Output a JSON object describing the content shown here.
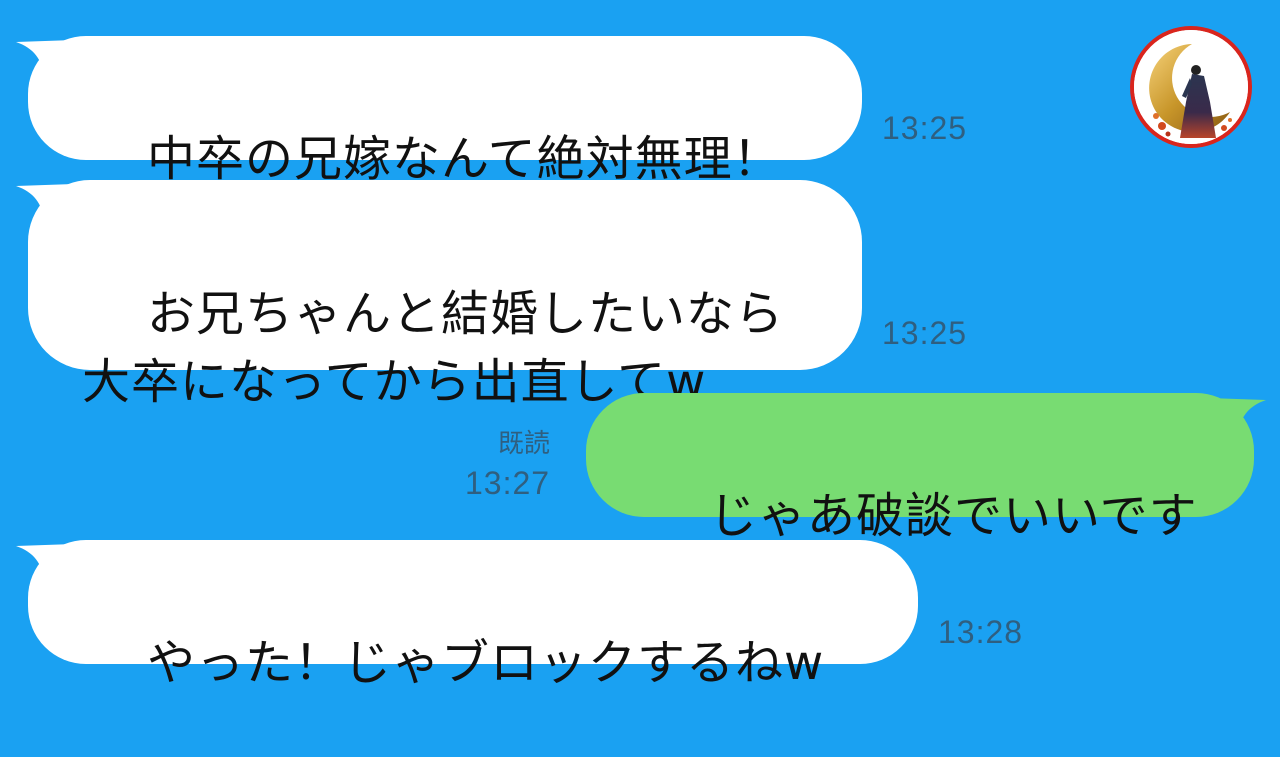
{
  "chat": {
    "messages": [
      {
        "sender": "other",
        "text": "中卒の兄嫁なんて絶対無理！",
        "time": "13:25"
      },
      {
        "sender": "other",
        "text": "お兄ちゃんと結婚したいなら\n大卒になってから出直してw",
        "time": "13:25"
      },
      {
        "sender": "self",
        "text": "じゃあ破談でいいです",
        "read": "既読",
        "time": "13:27"
      },
      {
        "sender": "other",
        "text": "やった！じゃブロックするねw",
        "time": "13:28"
      }
    ]
  },
  "colors": {
    "background": "#1aa1f2",
    "received_bubble": "#ffffff",
    "sent_bubble": "#78dc72",
    "meta_text": "#2f5f80",
    "avatar_border": "#d9251d"
  },
  "avatar": {
    "icon": "kimono-woman-crescent-moon-avatar"
  }
}
